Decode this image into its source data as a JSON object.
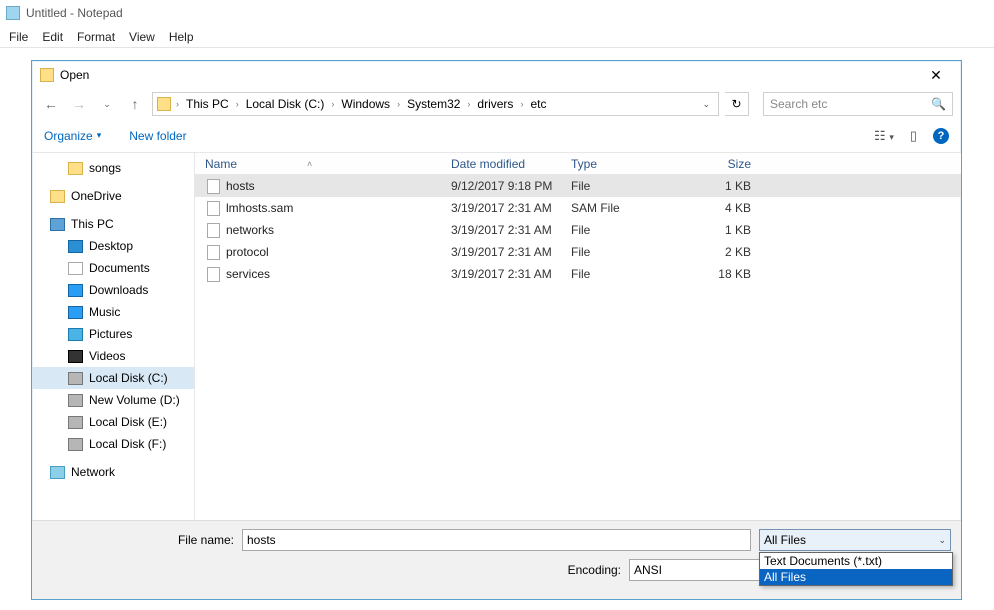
{
  "notepad": {
    "title": "Untitled - Notepad",
    "menu": [
      "File",
      "Edit",
      "Format",
      "View",
      "Help"
    ]
  },
  "dialog": {
    "title": "Open",
    "close_glyph": "✕",
    "nav": {
      "back_glyph": "←",
      "fwd_glyph": "→",
      "recent_glyph": "⌄",
      "up_glyph": "↑",
      "refresh_glyph": "↻",
      "path_chevron": "›"
    },
    "breadcrumb": [
      "This PC",
      "Local Disk (C:)",
      "Windows",
      "System32",
      "drivers",
      "etc"
    ],
    "search_placeholder": "Search etc",
    "toolbar": {
      "organize": "Organize",
      "organize_caret": "▾",
      "newfolder": "New folder",
      "view_list": "☷",
      "view_caret": "▾",
      "preview": "▯",
      "help": "?"
    },
    "tree": [
      {
        "label": "songs",
        "icon": "folder",
        "indent": true,
        "space_after": true
      },
      {
        "label": "OneDrive",
        "icon": "folder",
        "indent": false,
        "space_after": true
      },
      {
        "label": "This PC",
        "icon": "pc",
        "indent": false
      },
      {
        "label": "Desktop",
        "icon": "desk",
        "indent": true
      },
      {
        "label": "Documents",
        "icon": "doc",
        "indent": true
      },
      {
        "label": "Downloads",
        "icon": "dl",
        "indent": true
      },
      {
        "label": "Music",
        "icon": "mus",
        "indent": true
      },
      {
        "label": "Pictures",
        "icon": "pic",
        "indent": true
      },
      {
        "label": "Videos",
        "icon": "vid",
        "indent": true
      },
      {
        "label": "Local Disk (C:)",
        "icon": "drv",
        "indent": true,
        "selected": true
      },
      {
        "label": "New Volume (D:)",
        "icon": "drv",
        "indent": true
      },
      {
        "label": "Local Disk (E:)",
        "icon": "drv",
        "indent": true
      },
      {
        "label": "Local Disk (F:)",
        "icon": "drv",
        "indent": true,
        "space_after": true
      },
      {
        "label": "Network",
        "icon": "net",
        "indent": false
      }
    ],
    "columns": {
      "name": "Name",
      "sort_glyph": "˄",
      "date": "Date modified",
      "type": "Type",
      "size": "Size"
    },
    "files": [
      {
        "name": "hosts",
        "date": "9/12/2017 9:18 PM",
        "type": "File",
        "size": "1 KB",
        "selected": true
      },
      {
        "name": "lmhosts.sam",
        "date": "3/19/2017 2:31 AM",
        "type": "SAM File",
        "size": "4 KB"
      },
      {
        "name": "networks",
        "date": "3/19/2017 2:31 AM",
        "type": "File",
        "size": "1 KB"
      },
      {
        "name": "protocol",
        "date": "3/19/2017 2:31 AM",
        "type": "File",
        "size": "2 KB"
      },
      {
        "name": "services",
        "date": "3/19/2017 2:31 AM",
        "type": "File",
        "size": "18 KB"
      }
    ],
    "panel": {
      "filename_label": "File name:",
      "filename_value": "hosts",
      "encoding_label": "Encoding:",
      "encoding_value": "ANSI",
      "combo_caret": "⌄",
      "filetype_selected": "All Files",
      "filetype_options": [
        {
          "label": "Text Documents (*.txt)"
        },
        {
          "label": "All Files",
          "selected": true
        }
      ]
    }
  }
}
